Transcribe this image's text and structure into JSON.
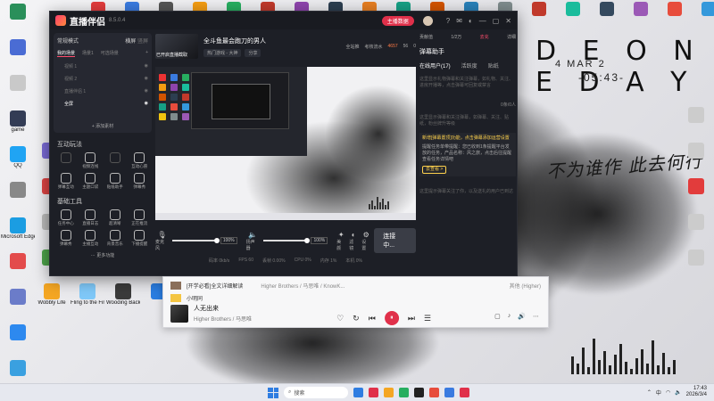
{
  "desktop": {
    "splash_title": "D E O N E   D A Y",
    "splash_date": "4 MAR 2",
    "splash_time": "-05:43-",
    "calligraphy": "不为谁作 此去何行",
    "left_icons": [
      {
        "label": "",
        "color": "#2a8f5a"
      },
      {
        "label": "",
        "color": "#4a6cd4"
      },
      {
        "label": "",
        "color": "#c9c9c9"
      },
      {
        "label": "game",
        "color": "#333c55"
      },
      {
        "label": "QQ",
        "color": "#20a4f3"
      },
      {
        "label": "",
        "color": "#888"
      },
      {
        "label": "Microsoft Edge",
        "color": "#1b9de2"
      },
      {
        "label": "",
        "color": "#e34b4b"
      },
      {
        "label": "",
        "color": "#6b7cc9"
      },
      {
        "label": "",
        "color": "#2d89ef"
      },
      {
        "label": "",
        "color": "#3aa0e0"
      },
      {
        "label": "",
        "color": "#e05a2d"
      },
      {
        "label": "",
        "color": "#5b8f3c"
      },
      {
        "label": "",
        "color": "#d94a8c"
      },
      {
        "label": "Wallpaper Engine",
        "color": "#2b5aa8"
      }
    ],
    "second_col_icons": [
      {
        "label": "",
        "color": "#7a6bd6"
      },
      {
        "label": "",
        "color": "#d44"
      },
      {
        "label": "",
        "color": "#bbb"
      },
      {
        "label": "",
        "color": "#4da34a"
      },
      {
        "label": "",
        "color": "#6d6d6d"
      },
      {
        "label": "",
        "color": "#2f8fd6"
      },
      {
        "label": "",
        "color": "#cc3f3f"
      },
      {
        "label": "Epic Games Launcher",
        "color": "#222"
      }
    ],
    "bottom_row_icons": [
      {
        "label": "Wobbly Life",
        "color": "#f4a623"
      },
      {
        "label": "Fling to the Finish",
        "color": "#7fc8f8"
      },
      {
        "label": "Wooding Background",
        "color": "#3b3b3b"
      },
      {
        "label": "",
        "color": "#2a7de1"
      }
    ],
    "top_row_icons": [
      {
        "label": "",
        "color": "#e23c3c"
      },
      {
        "label": "",
        "color": "#3a7be0"
      },
      {
        "label": "",
        "color": "#555"
      },
      {
        "label": "",
        "color": "#f39c12"
      },
      {
        "label": "",
        "color": "#27ae60"
      },
      {
        "label": "",
        "color": "#c0392b"
      },
      {
        "label": "",
        "color": "#8e44ad"
      },
      {
        "label": "",
        "color": "#2c3e50"
      },
      {
        "label": "",
        "color": "#e67e22"
      },
      {
        "label": "",
        "color": "#16a085"
      },
      {
        "label": "",
        "color": "#d35400"
      },
      {
        "label": "",
        "color": "#2980b9"
      },
      {
        "label": "",
        "color": "#7f8c8d"
      },
      {
        "label": "",
        "color": "#c0392b"
      },
      {
        "label": "",
        "color": "#1abc9c"
      },
      {
        "label": "",
        "color": "#34495e"
      },
      {
        "label": "",
        "color": "#9b59b6"
      },
      {
        "label": "",
        "color": "#e74c3c"
      },
      {
        "label": "",
        "color": "#3498db"
      },
      {
        "label": "",
        "color": "#95a5a6"
      }
    ],
    "right_col_icons": [
      {
        "label": "",
        "color": "#ccc"
      },
      {
        "label": "",
        "color": "#ccc"
      },
      {
        "label": "",
        "color": "#e23c3c"
      },
      {
        "label": "",
        "color": "#ccc"
      },
      {
        "label": "",
        "color": "#ccc"
      },
      {
        "label": "",
        "color": "#f1c40f"
      },
      {
        "label": "",
        "color": "#ccc"
      },
      {
        "label": "",
        "color": "#ccc"
      }
    ]
  },
  "app": {
    "name": "直播伴侣",
    "version": "8.5.0.4",
    "top_button": "主播数据",
    "title_icons": [
      "help-icon",
      "mail-icon",
      "skin-icon",
      "minimize-icon",
      "maximize-icon",
      "close-icon"
    ],
    "left": {
      "mode": "常规模式",
      "mode_right": [
        "横屏",
        "竖屏"
      ],
      "scene_tabs": [
        "我的场景",
        "场景1",
        "可选场景"
      ],
      "scene_items": [
        "视频 1",
        "视频 2",
        "直播伴侣 1",
        "全屏"
      ],
      "add_source": "添加素材",
      "interact_title": "互动玩法",
      "interact_items": [
        {
          "label": "",
          "dim": true
        },
        {
          "label": "视频连线",
          "dim": false
        },
        {
          "label": "",
          "dim": true
        },
        {
          "label": "互动心愿",
          "dim": false
        },
        {
          "label": "弹幕互动",
          "dim": false
        },
        {
          "label": "主题口袋",
          "dim": false
        },
        {
          "label": "贴纸助手",
          "dim": false
        },
        {
          "label": "弹幕秀",
          "dim": false
        }
      ],
      "tools_title": "基础工具",
      "tools_items": [
        {
          "label": "任务中心"
        },
        {
          "label": "直播日志"
        },
        {
          "label": "超清晰"
        },
        {
          "label": "正在推流"
        },
        {
          "label": "弹幕秀"
        },
        {
          "label": "主播互动"
        },
        {
          "label": "背景音乐"
        },
        {
          "label": "下播提醒"
        }
      ],
      "more_tools": "更多功能"
    },
    "stream": {
      "cover_caption": "已开启直播截取",
      "title": "全斗鱼最会跑刀的男人",
      "tags": [
        "热门游戏 - 大神",
        "分享"
      ],
      "stats": {
        "label1": "全站推",
        "label2": "考核流水",
        "value1": "4657",
        "value2": "56",
        "value3": "0"
      },
      "mic_label": "麦克风",
      "speaker_label": "扬声器",
      "mic_volume": "100%",
      "speaker_volume": "100%",
      "tools": [
        "美颜",
        "滤镜",
        "设置"
      ],
      "live_button": "连接中...",
      "status": [
        "码率 0kb/s",
        "FPS 60",
        "丢帧 0.00%",
        "CPU 0%",
        "内存 1%",
        "本机 0%"
      ]
    },
    "right": {
      "head_left": "贡献值",
      "head_mid": "1/2万",
      "head_right": "去充",
      "head_accent": "详细",
      "title": "弹幕助手",
      "tabs": [
        "在线用户(17)",
        "活跃度",
        "贴纸"
      ],
      "note1": "这里显示礼物弹幕和关注弹幕，如礼物、关注、进房开播等，点击弹幕可回复或禁言",
      "box_tag": "0条/0人",
      "note2": "这里显示弹幕和关注弹幕，如弹幕、关注、贴纸，粉丝牌升等级",
      "notice_title": "新增[弹幕置顶]功能，点击弹幕添加运营设置",
      "notice_body": "提醒任务单带提醒：您已收到1条提醒平台发放的任务，产品名称：风之旅，点击后往提醒查看任务详情吧",
      "notice_link": "去查看 >",
      "note3": "这里提示弹幕关注了你，以及送礼的用户已到达"
    }
  },
  "player": {
    "rows": [
      {
        "title": "[开学必看]全文详细解读",
        "meta": "Higher Brothers / 马思唯 / KnowK...",
        "right": "其他 (Higher)"
      },
      {
        "title": "小明同",
        "meta": "",
        "right": ""
      }
    ],
    "now_playing_title": "人无出来",
    "now_playing_artist": "Higher Brothers / 马思唯",
    "controls": [
      "♡",
      "↻",
      "⏮",
      "⏸",
      "⏭",
      "☰"
    ],
    "right_controls": [
      "▢",
      "♪",
      "🔊",
      "⋯"
    ]
  },
  "taskbar": {
    "search": "搜索",
    "time": "17:43",
    "date": "2026/3/4",
    "lang": "中",
    "apps": [
      "#2f7de1",
      "#e0304a",
      "#f4a623",
      "#27ae60",
      "#222",
      "#e74c3c",
      "#3a7be0",
      "#e0304a"
    ]
  }
}
